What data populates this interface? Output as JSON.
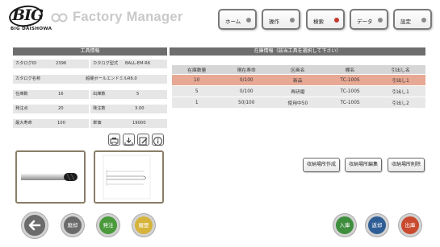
{
  "header": {
    "logo_main": "BIG",
    "logo_sub": "BIG DAISHOWA",
    "app_title": "Factory Manager",
    "nav": [
      {
        "label": "ホーム",
        "active": false
      },
      {
        "label": "操作",
        "active": false
      },
      {
        "label": "検索",
        "active": true
      },
      {
        "label": "データ",
        "active": false
      },
      {
        "label": "設定",
        "active": false
      }
    ]
  },
  "tool_info": {
    "title": "工具情報",
    "catalog_id_label": "カタログID",
    "catalog_id_value": "2396",
    "catalog_type_label": "カタログ型式",
    "catalog_type_value": "BALL-EM-R6",
    "catalog_name_label": "カタログ名称",
    "catalog_name_value": "超硬ボールエンドミルR6.0",
    "stock_count_label": "在庫数",
    "stock_count_value": "16",
    "out_count_label": "出庫数",
    "out_count_value": "5",
    "reorder_point_label": "発注点",
    "reorder_point_value": "20",
    "order_qty_label": "発注数",
    "order_qty_value": "3.00",
    "max_life_label": "最大寿命",
    "max_life_value": "100",
    "unit_price_label": "単価",
    "unit_price_value": "19000"
  },
  "stock_info": {
    "title": "在庫情報（該当工具を選択して下さい）",
    "columns": [
      "在庫数量",
      "現在寿命",
      "区画名",
      "棚名",
      "引出し名"
    ],
    "rows": [
      [
        "10",
        "0/100",
        "新品",
        "TC-100S",
        "引出し1"
      ],
      [
        "5",
        "0/100",
        "再研磨",
        "TC-100S",
        "引出し1"
      ],
      [
        "1",
        "50/100",
        "使用中50",
        "TC-100S",
        "引出し2"
      ]
    ],
    "selected_row": 0
  },
  "actions": {
    "create_location": "収納場所作成",
    "edit_location": "収納場所編集",
    "delete_location": "収納場所削除"
  },
  "footer": {
    "dispose": "廃却",
    "order": "発注",
    "history": "履歴",
    "stock_in": "入庫",
    "return": "返却",
    "stock_out": "出庫"
  },
  "colors": {
    "header_bar": "#6e6e6e",
    "selected_row": "#e7a894",
    "dispose_btn": "#6b6b6b",
    "order_btn": "#4a9a3c",
    "history_btn": "#d6b33a",
    "stock_in_btn": "#3e8e3e",
    "return_btn": "#2f5e96",
    "stock_out_btn": "#c94a2e"
  }
}
